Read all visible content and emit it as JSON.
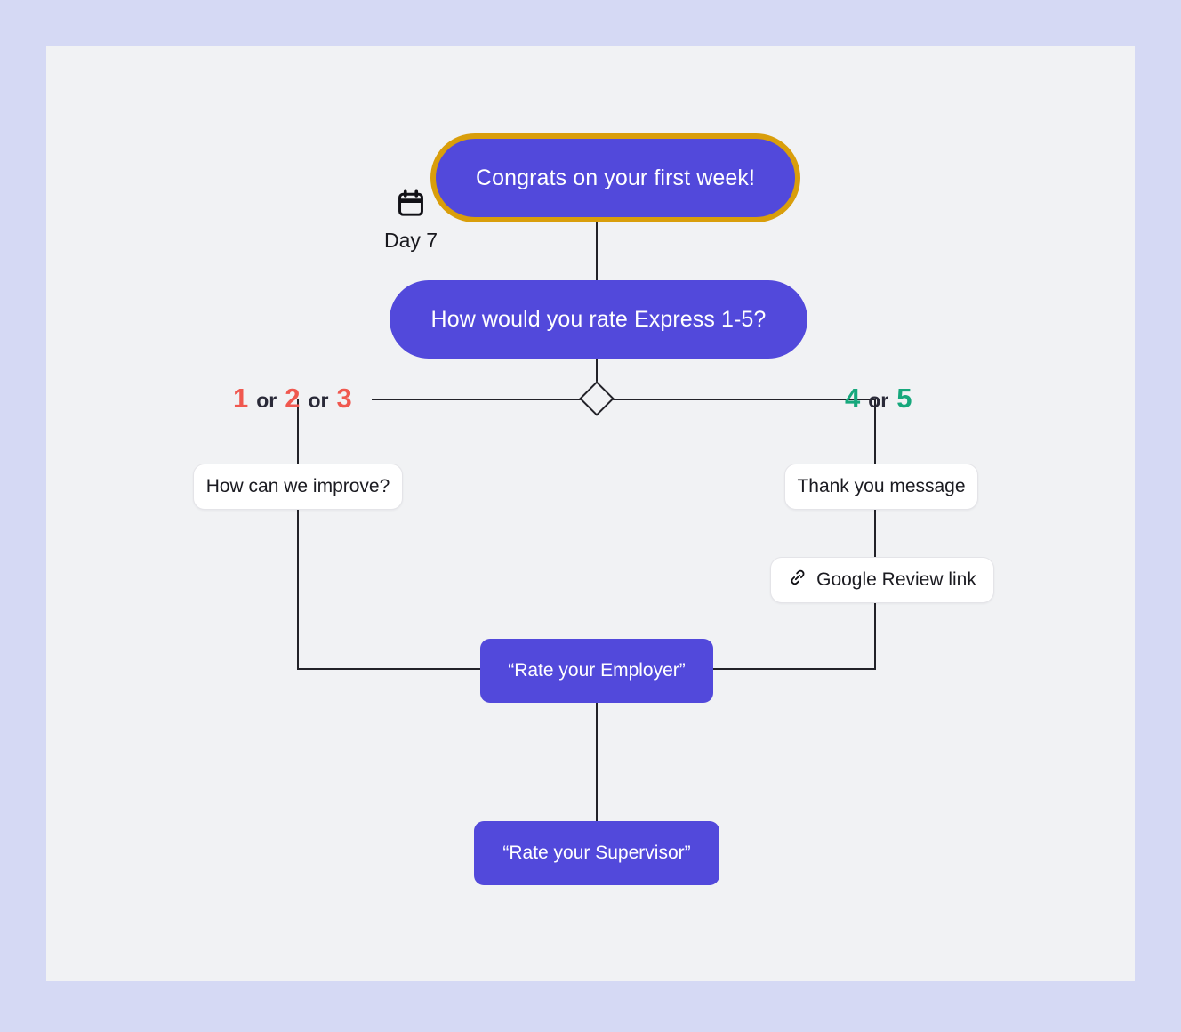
{
  "canvas": {
    "background_color": "#F1F2F4",
    "page_background_color": "#D5D9F4"
  },
  "day_marker": {
    "icon": "calendar-icon",
    "label": "Day 7"
  },
  "nodes": {
    "start": {
      "text": "Congrats on your first week!",
      "style": "purple-pill-highlighted",
      "fill_color": "#5249DB",
      "border_color": "#D99E0B",
      "text_color": "#FFFFFF"
    },
    "rating_question": {
      "text": "How would you rate Express 1-5?",
      "style": "purple-pill",
      "fill_color": "#5249DB",
      "text_color": "#FFFFFF"
    },
    "improve": {
      "text": "How can we improve?",
      "style": "white-card",
      "fill_color": "#FFFFFF",
      "text_color": "#1B1B21"
    },
    "thank_you": {
      "text": "Thank you message",
      "style": "white-card",
      "fill_color": "#FFFFFF",
      "text_color": "#1B1B21"
    },
    "google_review": {
      "icon": "link-icon",
      "text": "Google Review link",
      "style": "white-card",
      "fill_color": "#FFFFFF",
      "text_color": "#1B1B21"
    },
    "rate_employer": {
      "text": "“Rate your Employer”",
      "style": "purple-rect",
      "fill_color": "#5249DB",
      "text_color": "#FFFFFF"
    },
    "rate_supervisor": {
      "text": "“Rate your Supervisor”",
      "style": "purple-rect",
      "fill_color": "#5249DB",
      "text_color": "#FFFFFF"
    }
  },
  "branches": {
    "low": {
      "numbers": [
        "1",
        "2",
        "3"
      ],
      "conjunction": "or",
      "color": "#F0584F"
    },
    "high": {
      "numbers": [
        "4",
        "5"
      ],
      "conjunction": "or",
      "color": "#16A87C"
    }
  },
  "decision": {
    "shape": "diamond",
    "stroke_color": "#222228"
  }
}
